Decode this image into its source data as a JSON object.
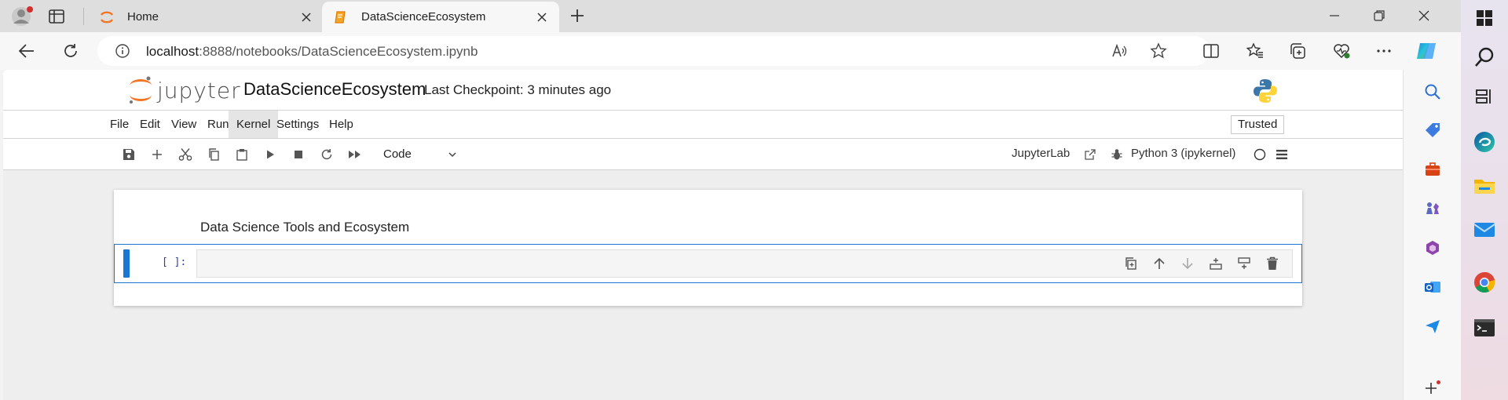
{
  "browser": {
    "tabs": [
      {
        "title": "Home",
        "favicon": "jupyter-icon",
        "active": false
      },
      {
        "title": "DataScienceEcosystem",
        "favicon": "notebook-icon",
        "active": true
      }
    ],
    "address": {
      "host": "localhost",
      "path": ":8888/notebooks/DataScienceEcosystem.ipynb"
    }
  },
  "jupyter": {
    "logo_text": "jupyter",
    "notebook_title": "DataScienceEcosystem",
    "checkpoint": "Last Checkpoint: 3 minutes ago",
    "menu": [
      "File",
      "Edit",
      "View",
      "Run",
      "Kernel",
      "Settings",
      "Help"
    ],
    "active_menu": "Kernel",
    "trusted_label": "Trusted",
    "cell_type": "Code",
    "jupyterlab_label": "JupyterLab",
    "kernel_label": "Python 3 (ipykernel)"
  },
  "cells": {
    "markdown_text": "Data Science Tools and Ecosystem",
    "code_prompt": "[ ]:"
  },
  "colors": {
    "accent": "#1976d2",
    "jupyter_orange": "#f37626"
  }
}
